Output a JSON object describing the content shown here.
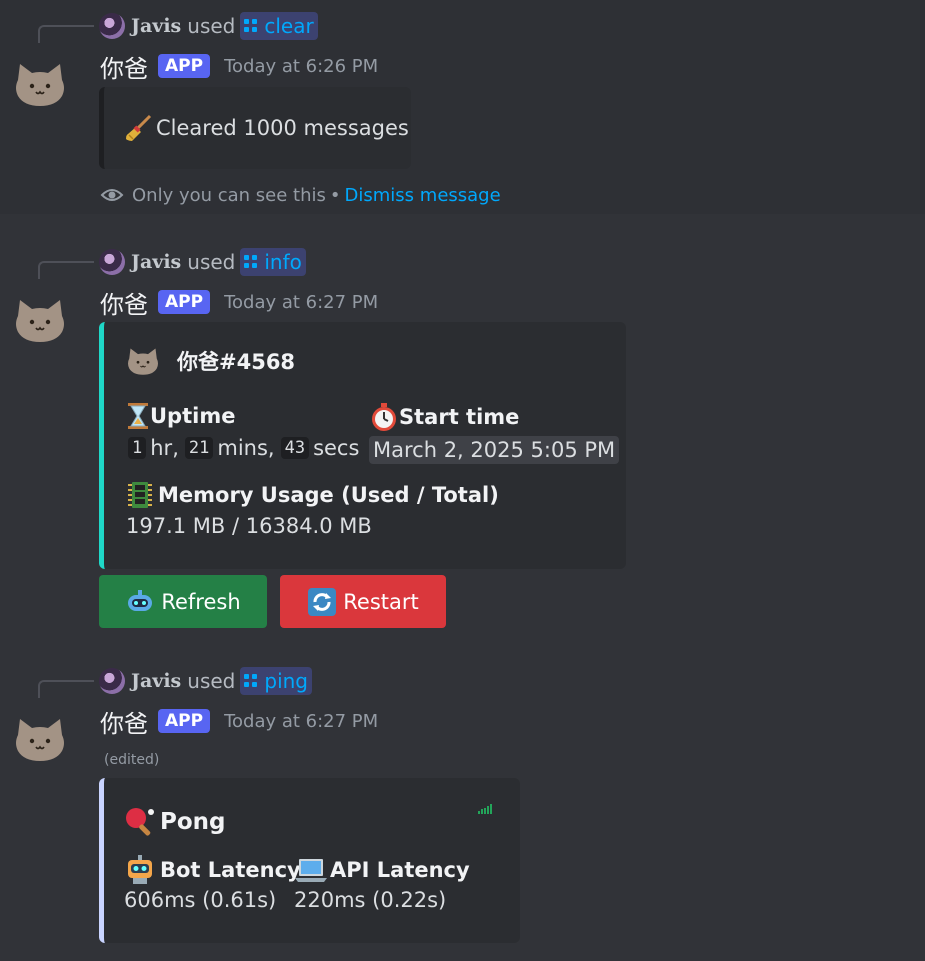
{
  "messages": [
    {
      "reply": {
        "name": "Javis",
        "used": "used",
        "command": "clear"
      },
      "username": "你爸",
      "badge": "APP",
      "timestamp": "Today at 6:26 PM",
      "embed_text": "Cleared 1000 messages",
      "ephemeral": {
        "note": "Only you can see this",
        "separator": "•",
        "dismiss": "Dismiss message"
      }
    },
    {
      "reply": {
        "name": "Javis",
        "used": "used",
        "command": "info"
      },
      "username": "你爸",
      "badge": "APP",
      "timestamp": "Today at 6:27 PM",
      "embed": {
        "accent": "#1fd8c8",
        "author": "你爸#4568",
        "uptime_title": "Uptime",
        "uptime": {
          "h": "1",
          "h_unit": "hr,",
          "m": "21",
          "m_unit": "mins,",
          "s": "43",
          "s_unit": "secs"
        },
        "start_title": "Start time",
        "start_value": "March 2, 2025 5:05 PM",
        "memory_title": "Memory Usage (Used / Total)",
        "memory_value": "197.1 MB / 16384.0 MB"
      },
      "buttons": {
        "refresh": "Refresh",
        "restart": "Restart"
      }
    },
    {
      "reply": {
        "name": "Javis",
        "used": "used",
        "command": "ping"
      },
      "username": "你爸",
      "badge": "APP",
      "timestamp": "Today at 6:27 PM",
      "edited": "(edited)",
      "embed": {
        "accent": "#c9d4ff",
        "title": "Pong",
        "bot_title": "Bot Latency",
        "bot_value": "606ms (0.61s)",
        "api_title": "API Latency",
        "api_value": "220ms (0.22s)"
      }
    }
  ],
  "colors": {
    "background": "#313338",
    "embed": "#2b2d31",
    "link": "#00a8fc",
    "app_badge": "#5865f2",
    "green": "#248046",
    "red": "#da373c"
  },
  "icons": [
    "cat-avatar-icon",
    "command-icon",
    "broom-icon",
    "eye-icon",
    "hourglass-icon",
    "stopwatch-icon",
    "memory-icon",
    "robot-icon",
    "refresh-icon",
    "ping-pong-icon",
    "laptop-icon",
    "signal-icon"
  ]
}
